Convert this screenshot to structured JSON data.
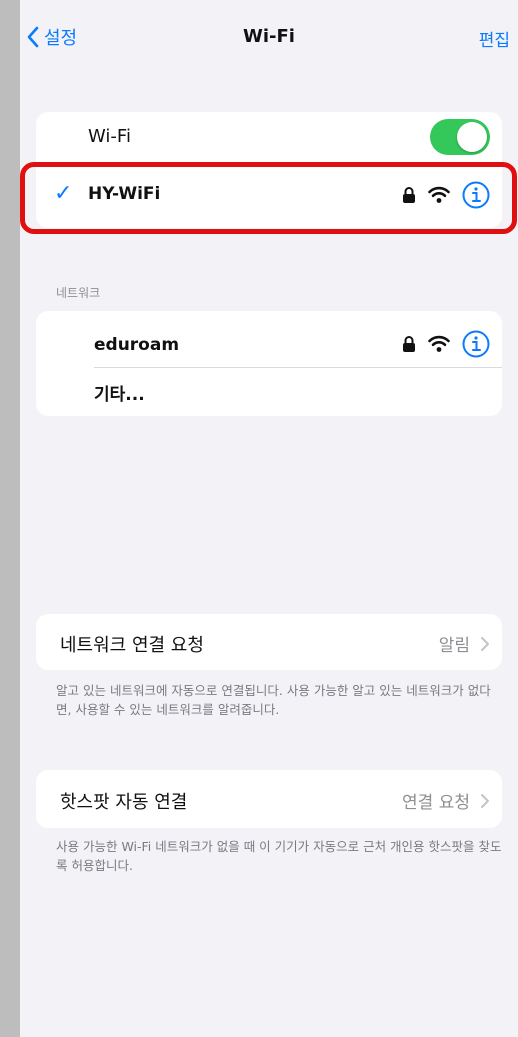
{
  "nav": {
    "back_label": "설정",
    "title": "Wi-Fi",
    "edit_label": "편집"
  },
  "wifi_card": {
    "toggle_label": "Wi-Fi",
    "toggle_on": true,
    "connected_network": "HY-WiFi",
    "checkmark": "✓"
  },
  "networks": {
    "header": "네트워크",
    "items": [
      {
        "name": "eduroam",
        "secured": true
      },
      {
        "name": "기타..."
      }
    ]
  },
  "ask_to_join": {
    "label": "네트워크 연결 요청",
    "value": "알림",
    "footer": "알고 있는 네트워크에 자동으로 연결됩니다. 사용 가능한 알고 있는 네트워크가 없다면, 사용할 수 있는 네트워크를 알려줍니다."
  },
  "hotspot": {
    "label": "핫스팟 자동 연결",
    "value": "연결 요청",
    "footer": "사용 가능한 Wi-Fi 네트워크가 없을 때 이 기기가 자동으로 근처 개인용 핫스팟을 찾도록 허용합니다."
  },
  "colors": {
    "accent": "#0a7aff",
    "toggle_on": "#34c759",
    "highlight": "#e01010"
  }
}
